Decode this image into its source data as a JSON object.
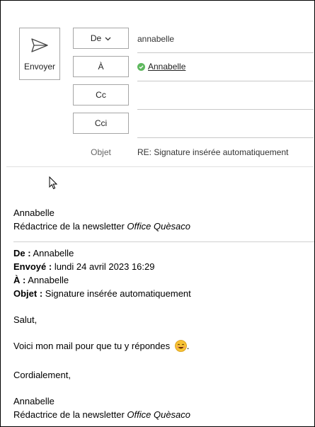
{
  "compose": {
    "send_label": "Envoyer",
    "from_label": "De",
    "from_value": "annabelle",
    "to_label": "À",
    "to_recipient": "Annabelle",
    "cc_label": "Cc",
    "bcc_label": "Cci",
    "subject_label": "Objet",
    "subject_value": "RE: Signature insérée automatiquement"
  },
  "body": {
    "signature_name": "Annabelle",
    "signature_role": "Rédactrice de la newsletter ",
    "signature_brand": "Office Quèsaco",
    "quoted": {
      "from_label": "De :",
      "from_value": "Annabelle",
      "sent_label": "Envoyé :",
      "sent_value": "lundi 24 avril 2023 16:29",
      "to_label": "À :",
      "to_value": "Annabelle",
      "subject_label": "Objet :",
      "subject_value": "Signature insérée automatiquement"
    },
    "greeting": "Salut,",
    "message": "Voici mon mail pour que tu y répondes ",
    "message_end": ".",
    "closing": "Cordialement,",
    "sig2_name": "Annabelle",
    "sig2_role": "Rédactrice de la newsletter ",
    "sig2_brand": "Office Quèsaco"
  },
  "icons": {
    "send": "send-icon",
    "chevron": "chevron-down-icon",
    "check": "check-circle-icon",
    "emoji": "smiling-face-icon",
    "cursor": "mouse-pointer-icon"
  },
  "colors": {
    "check_green": "#5eb85e",
    "emoji_yellow": "#f7c234"
  }
}
